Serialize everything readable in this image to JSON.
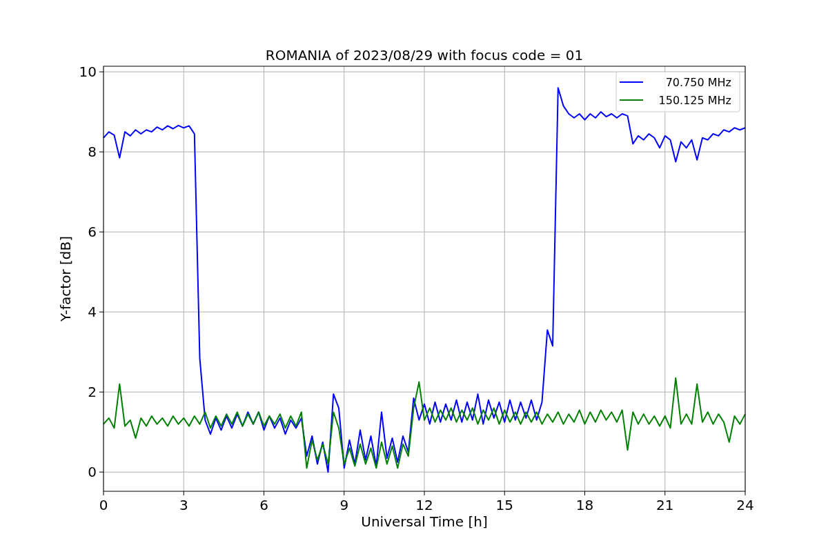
{
  "figure": {
    "chart_data": {
      "type": "line",
      "title": "ROMANIA of 2023/08/29 with focus code = 01",
      "xlabel": "Universal Time [h]",
      "ylabel": "Y-factor [dB]",
      "xlim": [
        0,
        24
      ],
      "ylim": [
        -0.48,
        10.14
      ],
      "grid": true,
      "legend": "upper right",
      "xticks": [
        0,
        3,
        6,
        9,
        12,
        15,
        18,
        21,
        24
      ],
      "yticks": [
        0,
        2,
        4,
        6,
        8,
        10
      ],
      "x": [
        0,
        0.2,
        0.4,
        0.6,
        0.8,
        1,
        1.2,
        1.4,
        1.6,
        1.8,
        2,
        2.2,
        2.4,
        2.6,
        2.8,
        3,
        3.2,
        3.4,
        3.6,
        3.8,
        4,
        4.2,
        4.4,
        4.6,
        4.8,
        5,
        5.2,
        5.4,
        5.6,
        5.8,
        6,
        6.2,
        6.4,
        6.6,
        6.8,
        7,
        7.2,
        7.4,
        7.6,
        7.8,
        8,
        8.2,
        8.4,
        8.6,
        8.8,
        9,
        9.2,
        9.4,
        9.6,
        9.8,
        10,
        10.2,
        10.4,
        10.6,
        10.8,
        11,
        11.2,
        11.4,
        11.6,
        11.8,
        12,
        12.2,
        12.4,
        12.6,
        12.8,
        13,
        13.2,
        13.4,
        13.6,
        13.8,
        14,
        14.2,
        14.4,
        14.6,
        14.8,
        15,
        15.2,
        15.4,
        15.6,
        15.8,
        16,
        16.2,
        16.4,
        16.6,
        16.8,
        17,
        17.2,
        17.4,
        17.6,
        17.8,
        18,
        18.2,
        18.4,
        18.6,
        18.8,
        19,
        19.2,
        19.4,
        19.6,
        19.8,
        20,
        20.2,
        20.4,
        20.6,
        20.8,
        21,
        21.2,
        21.4,
        21.6,
        21.8,
        22,
        22.2,
        22.4,
        22.6,
        22.8,
        23,
        23.2,
        23.4,
        23.6,
        23.8,
        24
      ],
      "series": [
        {
          "name": "70.750 MHz",
          "color": "#0000ff",
          "values": [
            8.35,
            8.5,
            8.42,
            7.85,
            8.5,
            8.4,
            8.55,
            8.45,
            8.55,
            8.5,
            8.62,
            8.55,
            8.65,
            8.58,
            8.66,
            8.6,
            8.65,
            8.45,
            2.85,
            1.3,
            0.95,
            1.35,
            1.05,
            1.4,
            1.1,
            1.45,
            1.15,
            1.5,
            1.2,
            1.5,
            1.05,
            1.4,
            1.1,
            1.35,
            0.95,
            1.3,
            1.1,
            1.35,
            0.4,
            0.9,
            0.2,
            0.75,
            0.0,
            1.95,
            1.6,
            0.1,
            0.8,
            0.2,
            1.05,
            0.3,
            0.9,
            0.15,
            1.5,
            0.35,
            0.85,
            0.25,
            0.9,
            0.5,
            1.85,
            1.3,
            1.7,
            1.2,
            1.75,
            1.25,
            1.7,
            1.3,
            1.8,
            1.25,
            1.75,
            1.3,
            1.95,
            1.2,
            1.8,
            1.35,
            1.75,
            1.25,
            1.8,
            1.3,
            1.75,
            1.35,
            1.8,
            1.3,
            1.75,
            3.55,
            3.15,
            9.6,
            9.15,
            8.95,
            8.85,
            8.95,
            8.8,
            8.95,
            8.85,
            9.0,
            8.88,
            8.95,
            8.85,
            8.95,
            8.9,
            8.2,
            8.4,
            8.3,
            8.45,
            8.35,
            8.1,
            8.4,
            8.3,
            7.75,
            8.25,
            8.1,
            8.3,
            7.8,
            8.35,
            8.3,
            8.45,
            8.4,
            8.55,
            8.5,
            8.6,
            8.55,
            8.6
          ]
        },
        {
          "name": "150.125 MHz",
          "color": "#008000",
          "values": [
            1.2,
            1.35,
            1.1,
            2.2,
            1.15,
            1.3,
            0.85,
            1.35,
            1.15,
            1.4,
            1.2,
            1.35,
            1.15,
            1.4,
            1.2,
            1.35,
            1.15,
            1.4,
            1.2,
            1.5,
            1.1,
            1.4,
            1.15,
            1.45,
            1.2,
            1.5,
            1.15,
            1.45,
            1.2,
            1.5,
            1.15,
            1.4,
            1.2,
            1.45,
            1.1,
            1.4,
            1.15,
            1.5,
            0.1,
            0.8,
            0.3,
            0.7,
            0.2,
            1.5,
            1.1,
            0.2,
            0.6,
            0.15,
            0.7,
            0.2,
            0.6,
            0.1,
            0.75,
            0.2,
            0.65,
            0.1,
            0.7,
            0.4,
            1.6,
            2.25,
            1.3,
            1.6,
            1.25,
            1.55,
            1.3,
            1.6,
            1.25,
            1.55,
            1.3,
            1.6,
            1.2,
            1.55,
            1.3,
            1.6,
            1.2,
            1.55,
            1.25,
            1.5,
            1.2,
            1.5,
            1.25,
            1.5,
            1.2,
            1.45,
            1.25,
            1.5,
            1.2,
            1.45,
            1.25,
            1.55,
            1.2,
            1.5,
            1.25,
            1.55,
            1.3,
            1.5,
            1.25,
            1.55,
            0.55,
            1.5,
            1.2,
            1.45,
            1.2,
            1.4,
            1.15,
            1.4,
            1.1,
            2.35,
            1.2,
            1.45,
            1.2,
            2.2,
            1.25,
            1.5,
            1.2,
            1.45,
            1.25,
            0.75,
            1.4,
            1.2,
            1.45
          ]
        }
      ]
    }
  }
}
